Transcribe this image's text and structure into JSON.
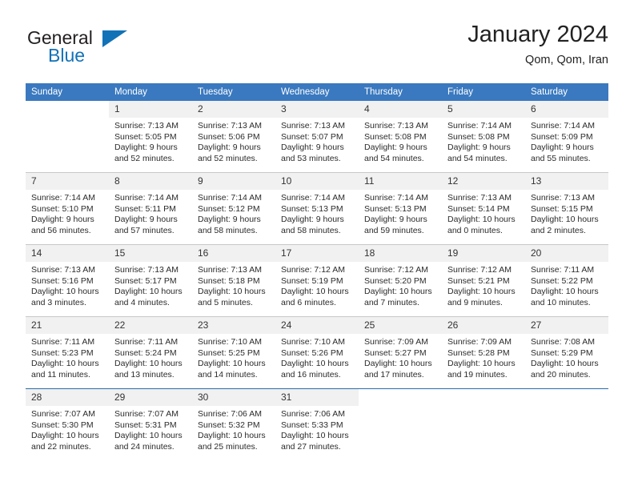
{
  "brand": {
    "name_dark": "General",
    "name_blue": "Blue",
    "logo_icon": "blue-triangle-icon"
  },
  "header": {
    "title": "January 2024",
    "subtitle": "Qom, Qom, Iran"
  },
  "colors": {
    "header_blue": "#3a79bf",
    "brand_blue": "#1272b8",
    "daynum_band": "#f1f1f1",
    "grid_line": "#c8c8c8",
    "last_row_line": "#2b6ca8"
  },
  "weekdays": [
    "Sunday",
    "Monday",
    "Tuesday",
    "Wednesday",
    "Thursday",
    "Friday",
    "Saturday"
  ],
  "weeks": [
    [
      {
        "day": "",
        "blank": true,
        "sunrise": "",
        "sunset": "",
        "daylight": ""
      },
      {
        "day": "1",
        "sunrise": "Sunrise: 7:13 AM",
        "sunset": "Sunset: 5:05 PM",
        "daylight": "Daylight: 9 hours and 52 minutes."
      },
      {
        "day": "2",
        "sunrise": "Sunrise: 7:13 AM",
        "sunset": "Sunset: 5:06 PM",
        "daylight": "Daylight: 9 hours and 52 minutes."
      },
      {
        "day": "3",
        "sunrise": "Sunrise: 7:13 AM",
        "sunset": "Sunset: 5:07 PM",
        "daylight": "Daylight: 9 hours and 53 minutes."
      },
      {
        "day": "4",
        "sunrise": "Sunrise: 7:13 AM",
        "sunset": "Sunset: 5:08 PM",
        "daylight": "Daylight: 9 hours and 54 minutes."
      },
      {
        "day": "5",
        "sunrise": "Sunrise: 7:14 AM",
        "sunset": "Sunset: 5:08 PM",
        "daylight": "Daylight: 9 hours and 54 minutes."
      },
      {
        "day": "6",
        "sunrise": "Sunrise: 7:14 AM",
        "sunset": "Sunset: 5:09 PM",
        "daylight": "Daylight: 9 hours and 55 minutes."
      }
    ],
    [
      {
        "day": "7",
        "sunrise": "Sunrise: 7:14 AM",
        "sunset": "Sunset: 5:10 PM",
        "daylight": "Daylight: 9 hours and 56 minutes."
      },
      {
        "day": "8",
        "sunrise": "Sunrise: 7:14 AM",
        "sunset": "Sunset: 5:11 PM",
        "daylight": "Daylight: 9 hours and 57 minutes."
      },
      {
        "day": "9",
        "sunrise": "Sunrise: 7:14 AM",
        "sunset": "Sunset: 5:12 PM",
        "daylight": "Daylight: 9 hours and 58 minutes."
      },
      {
        "day": "10",
        "sunrise": "Sunrise: 7:14 AM",
        "sunset": "Sunset: 5:13 PM",
        "daylight": "Daylight: 9 hours and 58 minutes."
      },
      {
        "day": "11",
        "sunrise": "Sunrise: 7:14 AM",
        "sunset": "Sunset: 5:13 PM",
        "daylight": "Daylight: 9 hours and 59 minutes."
      },
      {
        "day": "12",
        "sunrise": "Sunrise: 7:13 AM",
        "sunset": "Sunset: 5:14 PM",
        "daylight": "Daylight: 10 hours and 0 minutes."
      },
      {
        "day": "13",
        "sunrise": "Sunrise: 7:13 AM",
        "sunset": "Sunset: 5:15 PM",
        "daylight": "Daylight: 10 hours and 2 minutes."
      }
    ],
    [
      {
        "day": "14",
        "sunrise": "Sunrise: 7:13 AM",
        "sunset": "Sunset: 5:16 PM",
        "daylight": "Daylight: 10 hours and 3 minutes."
      },
      {
        "day": "15",
        "sunrise": "Sunrise: 7:13 AM",
        "sunset": "Sunset: 5:17 PM",
        "daylight": "Daylight: 10 hours and 4 minutes."
      },
      {
        "day": "16",
        "sunrise": "Sunrise: 7:13 AM",
        "sunset": "Sunset: 5:18 PM",
        "daylight": "Daylight: 10 hours and 5 minutes."
      },
      {
        "day": "17",
        "sunrise": "Sunrise: 7:12 AM",
        "sunset": "Sunset: 5:19 PM",
        "daylight": "Daylight: 10 hours and 6 minutes."
      },
      {
        "day": "18",
        "sunrise": "Sunrise: 7:12 AM",
        "sunset": "Sunset: 5:20 PM",
        "daylight": "Daylight: 10 hours and 7 minutes."
      },
      {
        "day": "19",
        "sunrise": "Sunrise: 7:12 AM",
        "sunset": "Sunset: 5:21 PM",
        "daylight": "Daylight: 10 hours and 9 minutes."
      },
      {
        "day": "20",
        "sunrise": "Sunrise: 7:11 AM",
        "sunset": "Sunset: 5:22 PM",
        "daylight": "Daylight: 10 hours and 10 minutes."
      }
    ],
    [
      {
        "day": "21",
        "sunrise": "Sunrise: 7:11 AM",
        "sunset": "Sunset: 5:23 PM",
        "daylight": "Daylight: 10 hours and 11 minutes."
      },
      {
        "day": "22",
        "sunrise": "Sunrise: 7:11 AM",
        "sunset": "Sunset: 5:24 PM",
        "daylight": "Daylight: 10 hours and 13 minutes."
      },
      {
        "day": "23",
        "sunrise": "Sunrise: 7:10 AM",
        "sunset": "Sunset: 5:25 PM",
        "daylight": "Daylight: 10 hours and 14 minutes."
      },
      {
        "day": "24",
        "sunrise": "Sunrise: 7:10 AM",
        "sunset": "Sunset: 5:26 PM",
        "daylight": "Daylight: 10 hours and 16 minutes."
      },
      {
        "day": "25",
        "sunrise": "Sunrise: 7:09 AM",
        "sunset": "Sunset: 5:27 PM",
        "daylight": "Daylight: 10 hours and 17 minutes."
      },
      {
        "day": "26",
        "sunrise": "Sunrise: 7:09 AM",
        "sunset": "Sunset: 5:28 PM",
        "daylight": "Daylight: 10 hours and 19 minutes."
      },
      {
        "day": "27",
        "sunrise": "Sunrise: 7:08 AM",
        "sunset": "Sunset: 5:29 PM",
        "daylight": "Daylight: 10 hours and 20 minutes."
      }
    ],
    [
      {
        "day": "28",
        "sunrise": "Sunrise: 7:07 AM",
        "sunset": "Sunset: 5:30 PM",
        "daylight": "Daylight: 10 hours and 22 minutes."
      },
      {
        "day": "29",
        "sunrise": "Sunrise: 7:07 AM",
        "sunset": "Sunset: 5:31 PM",
        "daylight": "Daylight: 10 hours and 24 minutes."
      },
      {
        "day": "30",
        "sunrise": "Sunrise: 7:06 AM",
        "sunset": "Sunset: 5:32 PM",
        "daylight": "Daylight: 10 hours and 25 minutes."
      },
      {
        "day": "31",
        "sunrise": "Sunrise: 7:06 AM",
        "sunset": "Sunset: 5:33 PM",
        "daylight": "Daylight: 10 hours and 27 minutes."
      },
      {
        "day": "",
        "sunrise": "",
        "sunset": "",
        "daylight": ""
      },
      {
        "day": "",
        "sunrise": "",
        "sunset": "",
        "daylight": ""
      },
      {
        "day": "",
        "sunrise": "",
        "sunset": "",
        "daylight": ""
      }
    ]
  ]
}
